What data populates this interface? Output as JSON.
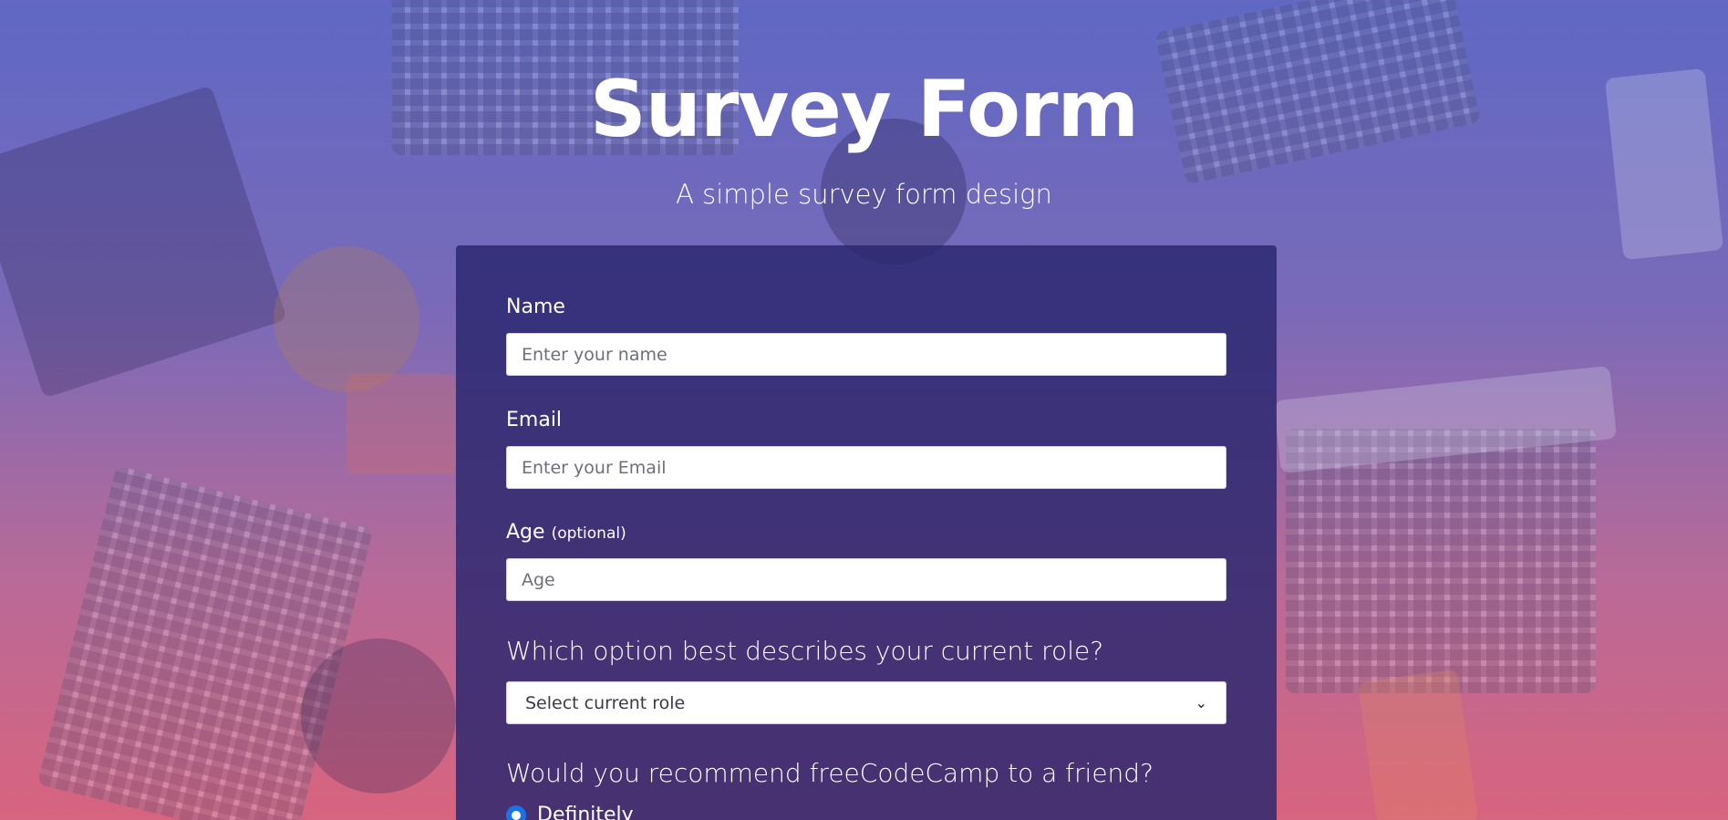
{
  "header": {
    "title": "Survey Form",
    "description": "A simple survey form design"
  },
  "form": {
    "name": {
      "label": "Name",
      "placeholder": "Enter your name",
      "value": ""
    },
    "email": {
      "label": "Email",
      "placeholder": "Enter your Email",
      "value": ""
    },
    "age": {
      "label": "Age",
      "label_note": "(optional)",
      "placeholder": "Age",
      "value": ""
    },
    "role": {
      "question": "Which option best describes your current role?",
      "selected": "Select current role"
    },
    "recommend": {
      "question": "Would you recommend freeCodeCamp to a friend?",
      "options": [
        {
          "label": "Definitely",
          "checked": true
        }
      ]
    }
  },
  "colors": {
    "card": "#28266e",
    "radio_accent": "#1a73e8",
    "text": "#ffffff"
  }
}
